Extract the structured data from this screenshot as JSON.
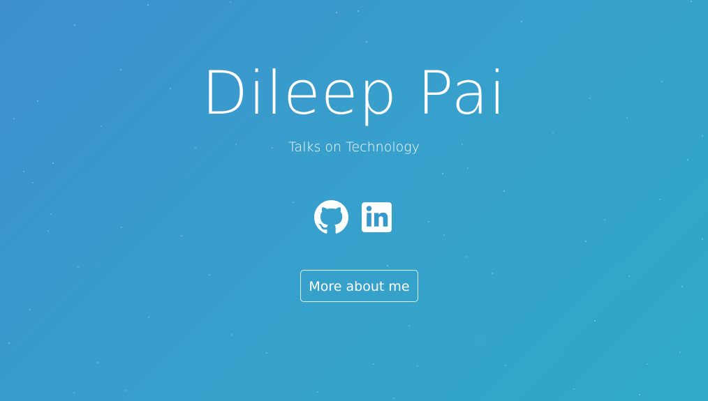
{
  "hero": {
    "title": "Dileep Pai",
    "subtitle": "Talks on Technology"
  },
  "social": {
    "items": [
      {
        "icon": "github-icon",
        "label": "GitHub"
      },
      {
        "icon": "linkedin-icon",
        "label": "LinkedIn"
      }
    ]
  },
  "cta": {
    "label": "More about me"
  },
  "colors": {
    "background_start": "#3d8fce",
    "background_end": "#30a9c8",
    "text": "#ffffff"
  }
}
